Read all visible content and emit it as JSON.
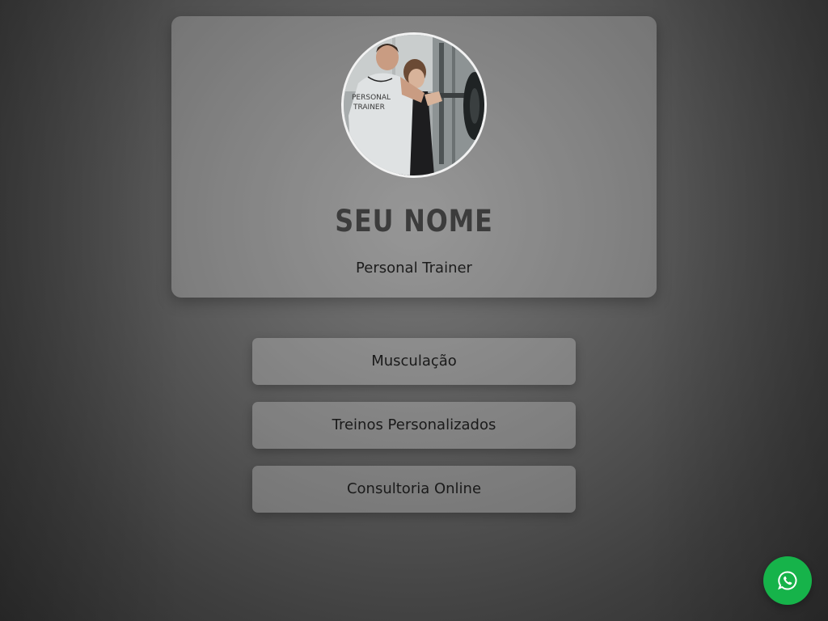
{
  "profile": {
    "name": "Seu Nome",
    "role": "Personal Trainer",
    "avatar": "personal-trainer-photo",
    "shirt_text": [
      "PERSONAL",
      "TRAINER"
    ]
  },
  "links": [
    {
      "label": "Musculação"
    },
    {
      "label": "Treinos Personalizados"
    },
    {
      "label": "Consultoria Online"
    }
  ],
  "floating_button": {
    "icon": "whatsapp-icon",
    "color": "#16b34a"
  },
  "colors": {
    "background": "#5e5e5e",
    "card": "rgba(255,255,255,0.22)",
    "name_text": "#3c3c3c"
  }
}
